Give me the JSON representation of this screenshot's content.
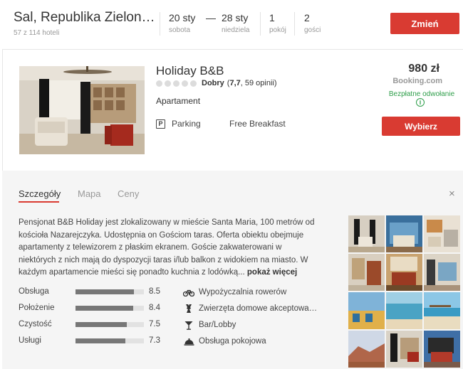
{
  "search": {
    "destination": "Sal, Republika Zielon…",
    "hotel_count": "57 z 114 hoteli",
    "checkin_date": "20 sty",
    "checkin_day": "sobota",
    "checkout_date": "28 sty",
    "checkout_day": "niedziela",
    "dash": "—",
    "rooms_value": "1",
    "rooms_label": "pokój",
    "guests_value": "2",
    "guests_label": "gości",
    "change_button": "Zmień"
  },
  "hotel": {
    "name": "Holiday B&B",
    "rating_word": "Dobry",
    "rating_open": "(",
    "rating_score": "7,7",
    "rating_reviews": ", 59 opinii)",
    "type": "Apartament",
    "amenity_1": "Parking",
    "amenity_1_icon": "P",
    "amenity_2": "Free Breakfast",
    "price": "980 zł",
    "provider": "Booking.com",
    "cancellation": "Bezpłatne odwołanie",
    "info_icon": "i",
    "select_button": "Wybierz"
  },
  "details": {
    "tabs": [
      "Szczegóły",
      "Mapa",
      "Ceny"
    ],
    "close": "×",
    "description": "Pensjonat B&B Holiday jest zlokalizowany w mieście Santa Maria, 100 metrów od kościoła Nazarejczyka. Udostępnia on Gościom taras. Oferta obiektu obejmuje apartamenty z telewizorem z płaskim ekranem. Goście zakwaterowani w niektórych z nich mają do dyspozycji taras i/lub balkon z widokiem na miasto. W każdym apartamencie mieści się ponadto kuchnia z lodówką...",
    "more": "pokaż więcej",
    "ratings": [
      {
        "label": "Obsługa",
        "value": "8.5",
        "score": 8.5
      },
      {
        "label": "Położenie",
        "value": "8.4",
        "score": 8.4
      },
      {
        "label": "Czystość",
        "value": "7.5",
        "score": 7.5
      },
      {
        "label": "Usługi",
        "value": "7.3",
        "score": 7.3
      }
    ],
    "facilities": [
      {
        "label": "Wypożyczalnia rowerów",
        "icon": "bicycle-icon"
      },
      {
        "label": "Zwierzęta domowe akceptowa…",
        "icon": "pet-icon"
      },
      {
        "label": "Bar/Lobby",
        "icon": "cocktail-icon"
      },
      {
        "label": "Obsługa pokojowa",
        "icon": "room-service-icon"
      }
    ]
  },
  "colors": {
    "accent": "#d93b32",
    "success": "#2e9e4a"
  }
}
